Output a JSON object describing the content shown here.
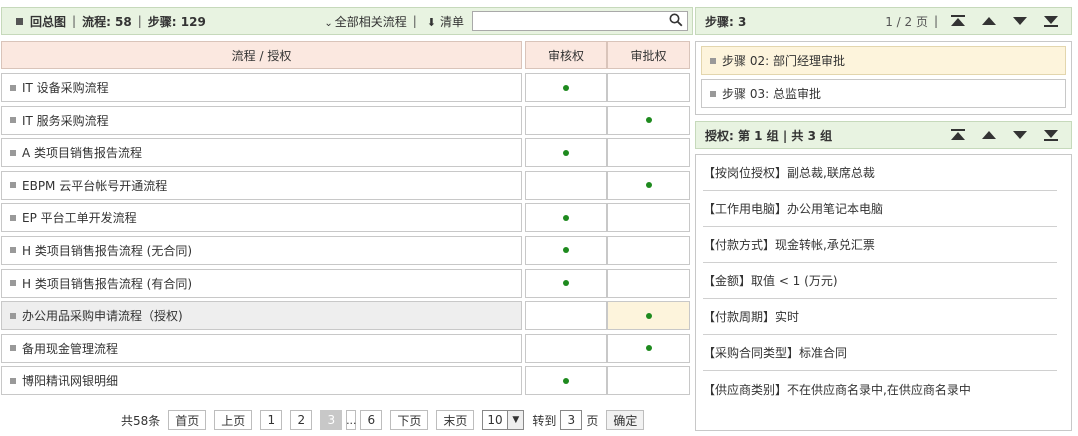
{
  "toolbar": {
    "title": "回总图",
    "flow_label": "流程: 58",
    "sep": "|",
    "step_label": "步骤: 129",
    "filter_label": "全部相关流程",
    "clear_label": "清单",
    "search_value": "",
    "search_placeholder": ""
  },
  "grid": {
    "headers": [
      "流程 / 授权",
      "审核权",
      "审批权"
    ],
    "rows": [
      {
        "name": "IT 设备采购流程",
        "review": true,
        "approve": false
      },
      {
        "name": "IT 服务采购流程",
        "review": false,
        "approve": true
      },
      {
        "name": "A 类项目销售报告流程",
        "review": true,
        "approve": false
      },
      {
        "name": "EBPM 云平台帐号开通流程",
        "review": false,
        "approve": true
      },
      {
        "name": "EP 平台工单开发流程",
        "review": true,
        "approve": false
      },
      {
        "name": "H 类项目销售报告流程 (无合同)",
        "review": true,
        "approve": false
      },
      {
        "name": "H 类项目销售报告流程 (有合同)",
        "review": true,
        "approve": false
      },
      {
        "name": "办公用品采购申请流程（授权)",
        "review": false,
        "approve": true,
        "selected": true
      },
      {
        "name": "备用现金管理流程",
        "review": false,
        "approve": true
      },
      {
        "name": "博阳精讯网银明细",
        "review": true,
        "approve": false
      }
    ]
  },
  "pager": {
    "total": "共58条",
    "first": "首页",
    "prev": "上页",
    "pages": [
      "1",
      "2",
      "3"
    ],
    "current": "3",
    "ellipsis": "...",
    "last_num": "6",
    "next": "下页",
    "last": "末页",
    "page_size": "10",
    "goto_prefix": "转到",
    "goto_value": "3",
    "goto_suffix": "页",
    "confirm": "确定"
  },
  "steps_panel": {
    "title": "步骤: 3",
    "page": "1 / 2 页",
    "sep": "|",
    "items": [
      {
        "label": "步骤 02:  部门经理审批",
        "active": true
      },
      {
        "label": "步骤 03:  总监审批",
        "active": false
      }
    ]
  },
  "auth_panel": {
    "title": "授权: 第 1 组 | 共 3 组",
    "items": [
      "【按岗位授权】副总裁,联席总裁",
      "【工作用电脑】办公用笔记本电脑",
      "【付款方式】现金转帐,承兑汇票",
      "【金额】取值 < 1 (万元)",
      "【付款周期】实时",
      "【采购合同类型】标准合同",
      "【供应商类别】不在供应商名录中,在供应商名录中"
    ]
  },
  "colors": {
    "bar_bg": "#e8f3e1",
    "header_bg": "#fbe8e0",
    "highlight": "#fdf4dc",
    "dot": "#1e8a1e"
  }
}
